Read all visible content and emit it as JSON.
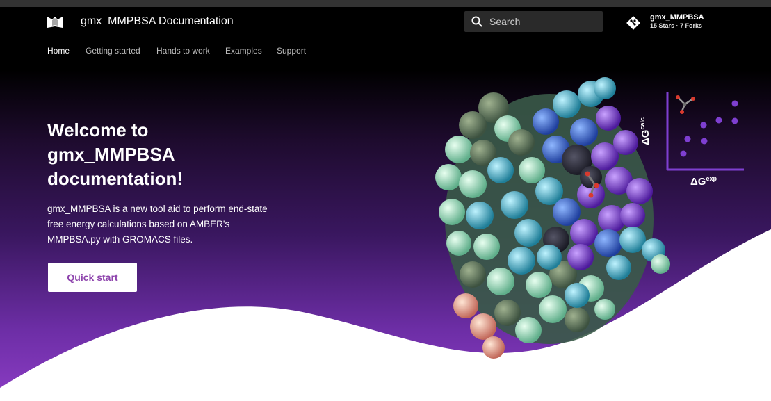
{
  "header": {
    "site_title": "gmx_MMPBSA Documentation",
    "search": {
      "placeholder": "Search"
    },
    "repo": {
      "name": "gmx_MMPBSA",
      "facts": "15 Stars · 7 Forks"
    }
  },
  "tabs": [
    {
      "label": "Home",
      "active": true
    },
    {
      "label": "Getting started"
    },
    {
      "label": "Hands to work"
    },
    {
      "label": "Examples"
    },
    {
      "label": "Support"
    }
  ],
  "hero": {
    "title": "Welcome to gmx_MMPBSA documentation!",
    "text": "gmx_MMPBSA is a new tool aid to perform end-state free energy calculations based on AMBER's MMPBSA.py with GROMACS files.",
    "cta_label": "Quick start"
  },
  "illustration": {
    "y_label_main": "ΔG",
    "y_label_sup": "calc",
    "x_label_main": "ΔG",
    "x_label_sup": "exp"
  },
  "colors": {
    "accent": "#8e44ad",
    "gradient_bottom": "#8b3cc4",
    "plot_violet": "#7e3fd0"
  }
}
